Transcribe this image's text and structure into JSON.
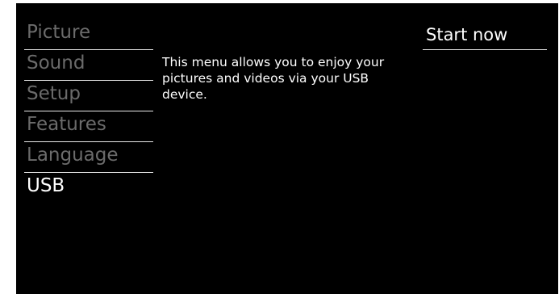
{
  "menu": {
    "items": [
      {
        "label": "Picture"
      },
      {
        "label": "Sound"
      },
      {
        "label": "Setup"
      },
      {
        "label": "Features"
      },
      {
        "label": "Language"
      },
      {
        "label": "USB"
      }
    ],
    "selected": "USB"
  },
  "description": "This menu allows you to enjoy your pictures and videos via your USB device.",
  "action": {
    "label": "Start now"
  }
}
